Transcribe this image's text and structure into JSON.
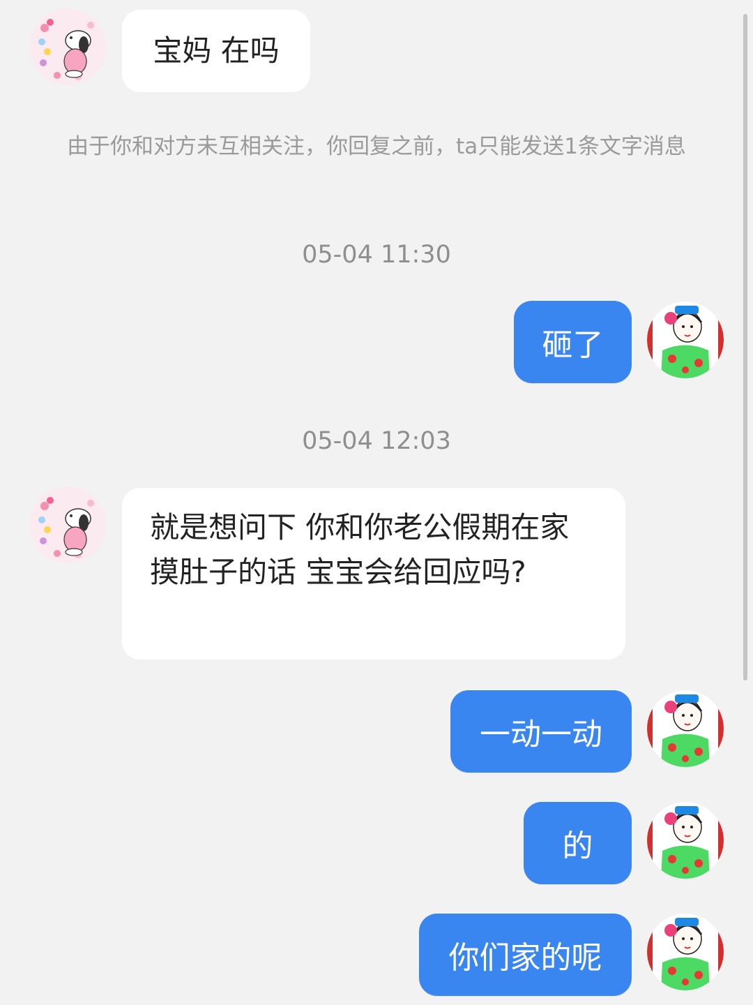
{
  "messages": {
    "m1": "宝妈 在吗",
    "notice": "由于你和对方未互相关注，你回复之前，ta只能发送1条文字消息",
    "time1": "05-04 11:30",
    "m2": "砸了",
    "time2": "05-04 12:03",
    "m3_line1": "就是想问下 你和你老公假期在家",
    "m3_line2": "摸肚子的话 宝宝会给回应吗?",
    "m4": "一动一动",
    "m5": "的",
    "m6": "你们家的呢"
  },
  "colors": {
    "background": "#f2f2f2",
    "outgoing_bubble": "#3a86f0",
    "incoming_bubble": "#ffffff"
  },
  "icons": {
    "contact_avatar": "snoopy-avatar-icon",
    "self_avatar": "illustrated-girl-avatar-icon"
  }
}
